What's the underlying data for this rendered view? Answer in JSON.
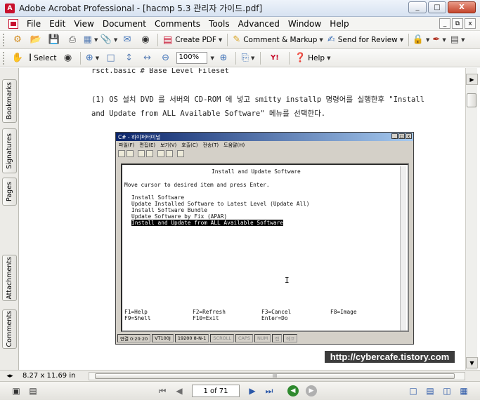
{
  "window": {
    "title": "Adobe Acrobat Professional - [hacmp 5.3 관리자 가이드.pdf]",
    "buttons": [
      "_",
      "□",
      "X"
    ]
  },
  "menubar": {
    "items": [
      "File",
      "Edit",
      "View",
      "Document",
      "Comments",
      "Tools",
      "Advanced",
      "Window",
      "Help"
    ],
    "mdi_buttons": [
      "_",
      "⧉",
      "x"
    ]
  },
  "toolbar1": {
    "create_pdf": "Create PDF",
    "comment_markup": "Comment & Markup",
    "send_for_review": "Send for Review"
  },
  "toolbar2": {
    "select": "Select",
    "zoom": "100%",
    "help": "Help"
  },
  "left_tabs": [
    "Bookmarks",
    "Signatures",
    "Pages",
    "Attachments",
    "Comments"
  ],
  "document": {
    "line_top": "rsct.basic                # Base Level Fileset",
    "para_line1": "(1) OS 설치 DVD 를 서버의 CD-ROM 에 넣고 smitty installp 명령어를 실행한후  \"Install",
    "para_line2": "and Update from ALL Available Software\"  메뉴를 선택한다."
  },
  "terminal": {
    "title": "C# - 하이퍼터미널",
    "menu": [
      "파일(F)",
      "편집(E)",
      "보기(V)",
      "호출(C)",
      "전송(T)",
      "도움말(H)"
    ],
    "screen_title": "Install and Update Software",
    "prompt": "Move cursor to desired item and press Enter.",
    "items": [
      "Install Software",
      "Update Installed Software to Latest Level (Update All)",
      "Install Software Bundle",
      "Update Software by Fix (APAR)",
      "Install and Update from ALL Available Software"
    ],
    "fkeys_row1": [
      "F1=Help",
      "F2=Refresh",
      "F3=Cancel",
      "F8=Image"
    ],
    "fkeys_row2": [
      "F9=Shell",
      "F10=Exit",
      "Enter=Do",
      ""
    ],
    "cursor": "I",
    "status": [
      "연결 0:20:20",
      "VT100J",
      "19200 8-N-1",
      "SCROLL",
      "CAPS",
      "NUM",
      "캡",
      "에코"
    ]
  },
  "watermark": "http://cybercafe.tistory.com",
  "bottom": {
    "page_size": "8.27 x 11.69 in",
    "page_indicator": "1 of 71",
    "expand": "◂▸",
    "hscroll_grip": "III"
  }
}
